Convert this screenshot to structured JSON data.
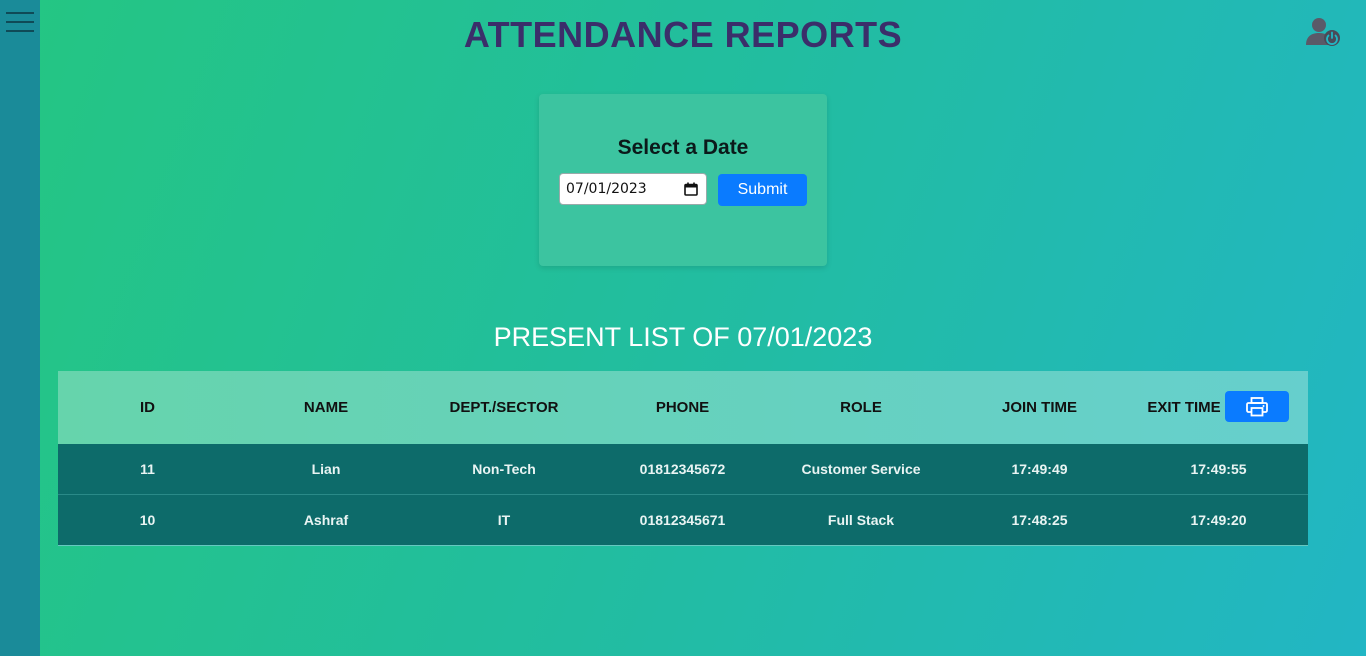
{
  "header": {
    "title": "ATTENDANCE REPORTS"
  },
  "date_picker": {
    "heading": "Select a Date",
    "date_value": "07/01/2023",
    "submit_label": "Submit"
  },
  "list": {
    "heading": "PRESENT LIST OF 07/01/2023",
    "columns": [
      "ID",
      "NAME",
      "DEPT./SECTOR",
      "PHONE",
      "ROLE",
      "JOIN TIME",
      "EXIT TIME"
    ],
    "rows": [
      [
        "11",
        "Lian",
        "Non-Tech",
        "01812345672",
        "Customer Service",
        "17:49:49",
        "17:49:55"
      ],
      [
        "10",
        "Ashraf",
        "IT",
        "01812345671",
        "Full Stack",
        "17:48:25",
        "17:49:20"
      ]
    ]
  },
  "icons": {
    "menu": "hamburger-menu-icon",
    "user": "user-logout-icon",
    "print": "printer-icon",
    "calendar": "calendar-icon"
  },
  "colors": {
    "title": "#3b2e6a",
    "accent_button": "#0a7bff",
    "table_row_bg": "#0d6b6a"
  }
}
